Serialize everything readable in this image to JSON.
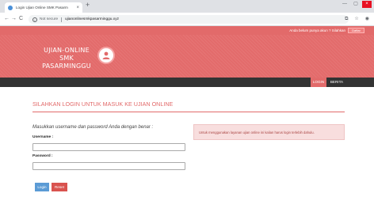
{
  "browser": {
    "tab_title": "Login Ujian Online SMK Pasarm",
    "tab_close": "×",
    "new_tab": "+",
    "not_secure": "Not secure",
    "url": "ujianonlinesmkpasarminggu.xyz",
    "info_icon": "i",
    "back": "←",
    "forward": "→",
    "reload": "C",
    "win_min": "—",
    "win_max": "▢",
    "win_close": "×",
    "translate_icon": "⧉",
    "star_icon": "☆",
    "profile_icon": "◉"
  },
  "topbar": {
    "text": "Anda belum punya akun ? Silahkan",
    "daftar": "Daftar"
  },
  "header": {
    "brand_line1": "UJIAN-ONLINE",
    "brand_line2": "SMK PASARMINGGU"
  },
  "nav": {
    "login": "LOGIN",
    "berita": "BERITA"
  },
  "main": {
    "title": "SILAHKAN LOGIN UNTUK MASUK KE UJIAN ONLINE",
    "prompt": "Masukkan username dan password Anda dengan benar :",
    "username_label": "Username :",
    "password_label": "Password :",
    "username_value": "",
    "password_value": "",
    "login_button": "Login",
    "reset_button": "Reset",
    "info_text": "Untuk menggunakan layanan ujian online ini kalian harus login terlebih dahulu."
  },
  "colors": {
    "accent": "#e26a6a",
    "nav_bg": "#333333",
    "login_btn": "#5b9bd5",
    "reset_btn": "#d9534f",
    "info_bg": "#f8dede"
  },
  "icons": {
    "avatar": "user-icon",
    "favicon": "site-favicon"
  }
}
